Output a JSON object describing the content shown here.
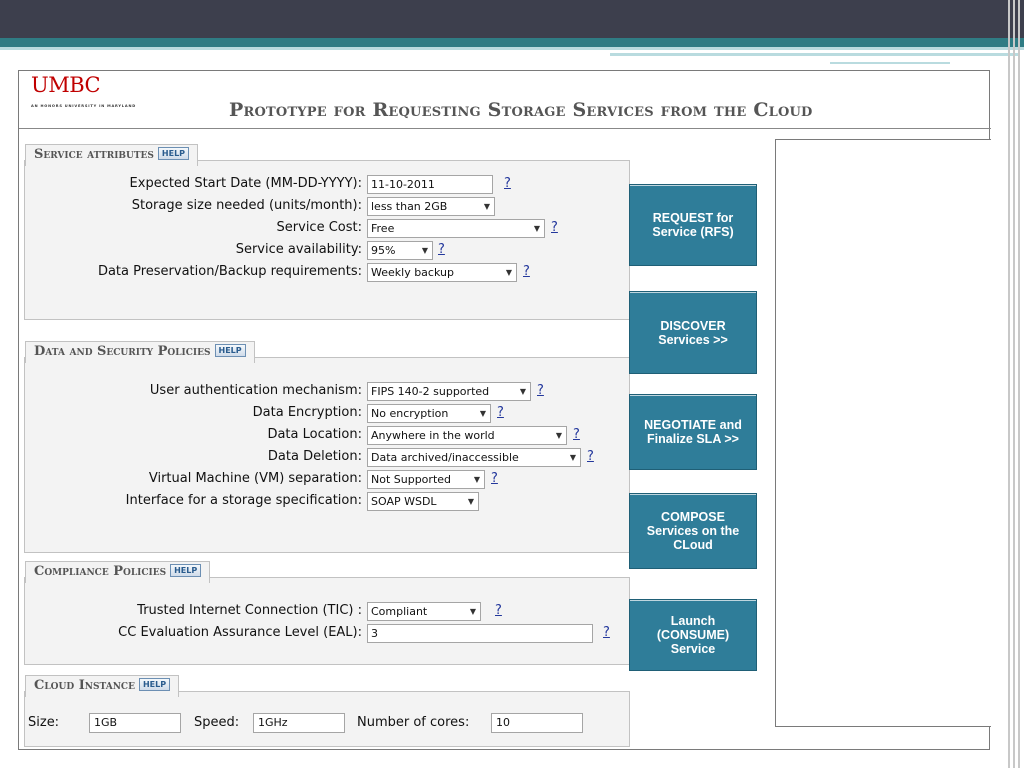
{
  "header": {
    "logo": "UMBC",
    "logo_subtitle": "AN HONORS UNIVERSITY IN MARYLAND",
    "title": "Prototype for Requesting Storage Services from the Cloud"
  },
  "help_label": "HELP",
  "question_mark": "?",
  "sections": {
    "service_attributes": {
      "title": "Service attributes",
      "fields": {
        "start_date": {
          "label": "Expected Start Date (MM-DD-YYYY):",
          "value": "11-10-2011"
        },
        "storage_size": {
          "label": "Storage size needed (units/month):",
          "value": "less than 2GB"
        },
        "service_cost": {
          "label": "Service Cost:",
          "value": "Free"
        },
        "availability": {
          "label": "Service availability:",
          "value": "95%"
        },
        "preservation": {
          "label": "Data Preservation/Backup requirements:",
          "value": "Weekly backup"
        }
      }
    },
    "data_security": {
      "title": "Data and Security Policies",
      "fields": {
        "auth": {
          "label": "User authentication mechanism:",
          "value": "FIPS 140-2 supported"
        },
        "encryption": {
          "label": "Data Encryption:",
          "value": "No encryption"
        },
        "location": {
          "label": "Data Location:",
          "value": "Anywhere in the world"
        },
        "deletion": {
          "label": "Data Deletion:",
          "value": "Data archived/inaccessible"
        },
        "vm_separation": {
          "label": "Virtual Machine (VM) separation:",
          "value": "Not Supported"
        },
        "interface": {
          "label": "Interface for a storage specification:",
          "value": "SOAP WSDL"
        }
      }
    },
    "compliance": {
      "title": "Compliance Policies",
      "fields": {
        "tic": {
          "label": "Trusted Internet Connection (TIC) :",
          "value": "Compliant"
        },
        "eal": {
          "label": "CC Evaluation Assurance Level (EAL):",
          "value": "3"
        }
      }
    },
    "cloud_instance": {
      "title": "Cloud Instance",
      "size_label": "Size:",
      "size_value": "1GB",
      "speed_label": "Speed:",
      "speed_value": "1GHz",
      "cores_label": "Number of cores:",
      "cores_value": "10"
    }
  },
  "actions": {
    "request": "REQUEST for Service (RFS)",
    "discover": "DISCOVER Services >>",
    "negotiate": "NEGOTIATE and Finalize SLA >>",
    "compose": "COMPOSE Services on the CLoud",
    "launch": "Launch (CONSUME) Service"
  },
  "colors": {
    "logo": "#c00000",
    "button": "#2f7d99",
    "link": "#23379c",
    "slide_bar": "#3d3f4d",
    "slide_band": "#2f7c84"
  }
}
